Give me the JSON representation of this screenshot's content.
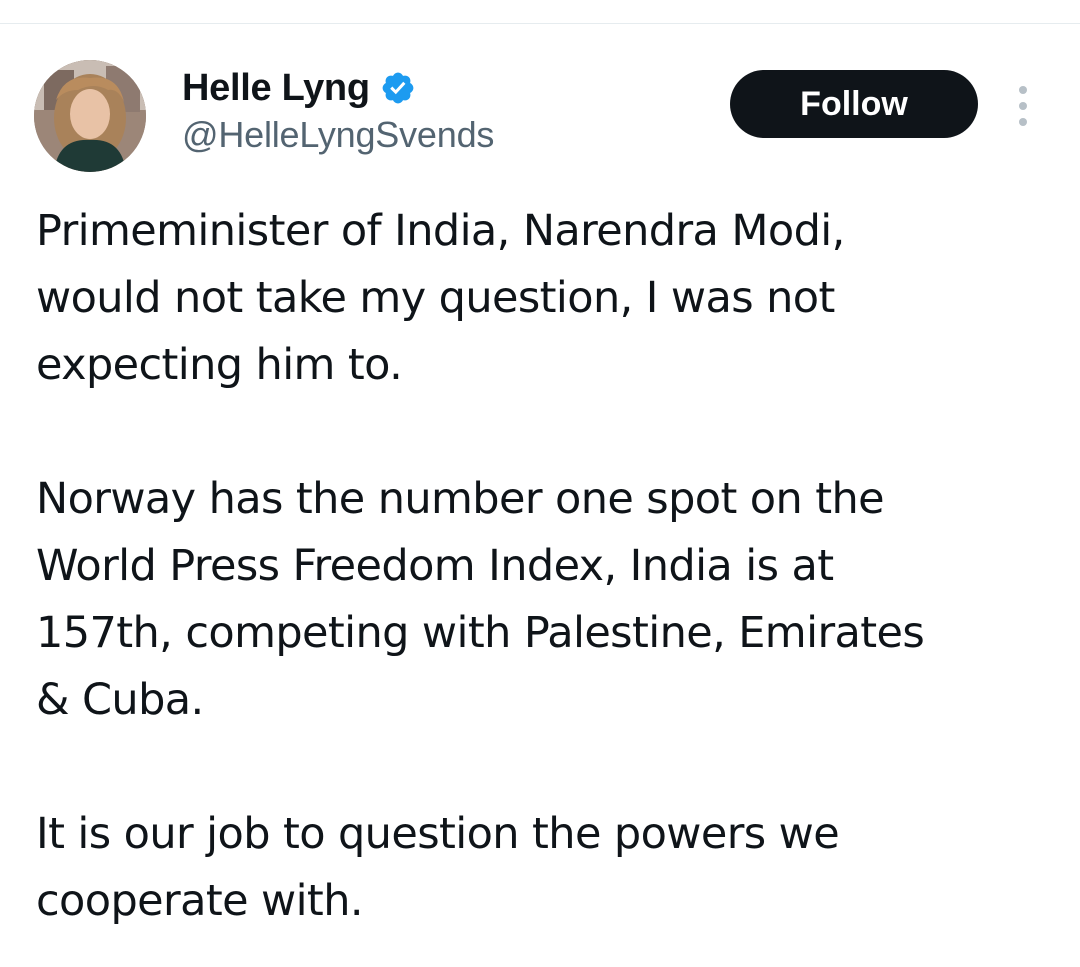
{
  "author": {
    "display_name": "Helle Lyng",
    "handle": "@HelleLyngSvends",
    "verified": true,
    "avatar_icon": "profile-photo",
    "verified_icon": "verified-badge-icon",
    "verified_color": "#1d9bf0"
  },
  "actions": {
    "follow_label": "Follow",
    "more_icon": "more-vertical-icon"
  },
  "tweet": {
    "paragraphs": [
      "Primeminister of India, Narendra Modi,\nwould not take my question, I was not\nexpecting him to.",
      "Norway has the number one spot on the\nWorld Press Freedom Index, India is at\n157th, competing with Palestine, Emirates\n& Cuba.",
      "It is our job to question the powers we\ncooperate with."
    ]
  },
  "colors": {
    "text_primary": "#0f1419",
    "text_secondary": "#536471",
    "button_bg": "#0f1419",
    "button_text": "#ffffff",
    "divider": "#e6ecef"
  }
}
